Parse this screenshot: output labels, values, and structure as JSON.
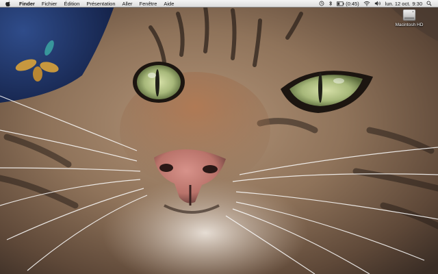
{
  "menubar": {
    "apple_icon": "apple-logo-icon",
    "app_name": "Finder",
    "menus": [
      "Fichier",
      "Édition",
      "Présentation",
      "Aller",
      "Fenêtre",
      "Aide"
    ],
    "status": {
      "battery_time": "(0:45)",
      "date": "lun. 12 oct.",
      "time": "9:30"
    }
  },
  "desktop": {
    "wallpaper": "tabby-cat-closeup",
    "icons": [
      {
        "label": "Macintosh HD",
        "icon": "hard-drive-icon"
      }
    ]
  },
  "colors": {
    "menubar_bg": "#e8e8e8",
    "eye_green": "#a7b87a",
    "fur_brown": "#8a6a4e",
    "nose_pink": "#c07a70",
    "wallpaper_corner_blue": "#243a6e"
  }
}
